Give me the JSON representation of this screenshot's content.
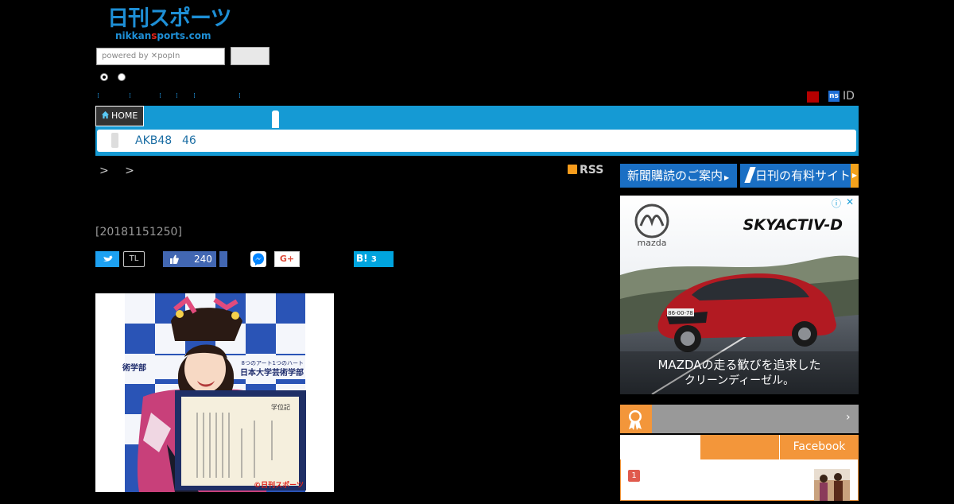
{
  "header": {
    "logo_main": "日刊スポーツ",
    "logo_sub_a": "nikkan",
    "logo_sub_b": "s",
    "logo_sub_c": "ports.com",
    "search_placeholder": "powered by ✕popIn",
    "id_label": "ID",
    "ns_label": "ns"
  },
  "nav": {
    "home_label": "HOME",
    "sub_links": [
      "AKB48",
      "46"
    ]
  },
  "breadcrumb": "> >",
  "rss_label": "RSS",
  "article": {
    "date": "[20181151250]",
    "share": {
      "tl_label": "TL",
      "fb_count": "240",
      "gp_label": "G+",
      "hb_label": "B!",
      "hb_count": "3"
    },
    "photo_credit": "©日刊スポーツ",
    "photo_sign_1": "8つのアート1つのハート",
    "photo_sign_2": "日本大学芸術学部",
    "photo_sign_3": "術学部",
    "diploma_title": "学位記"
  },
  "sidebar": {
    "promo_1": "新聞購読のご案内",
    "promo_2": "日刊の有料サイト",
    "ad": {
      "brand": "mazda",
      "headline": "SKYACTIV-D",
      "plate": "86-00-78",
      "copy_1": "MAZDAの走る歓びを追求した",
      "copy_2": "クリーンディーゼル。",
      "info_icon": "ⓘ",
      "close_icon": "✕"
    },
    "ranking": {
      "tab_c": "Facebook",
      "item_1_rank": "1"
    }
  },
  "colors": {
    "nav_blue": "#159ad4",
    "promo_blue": "#1a6fc4",
    "ranking_orange": "#f3963a",
    "ad_car_red": "#b21a22"
  }
}
